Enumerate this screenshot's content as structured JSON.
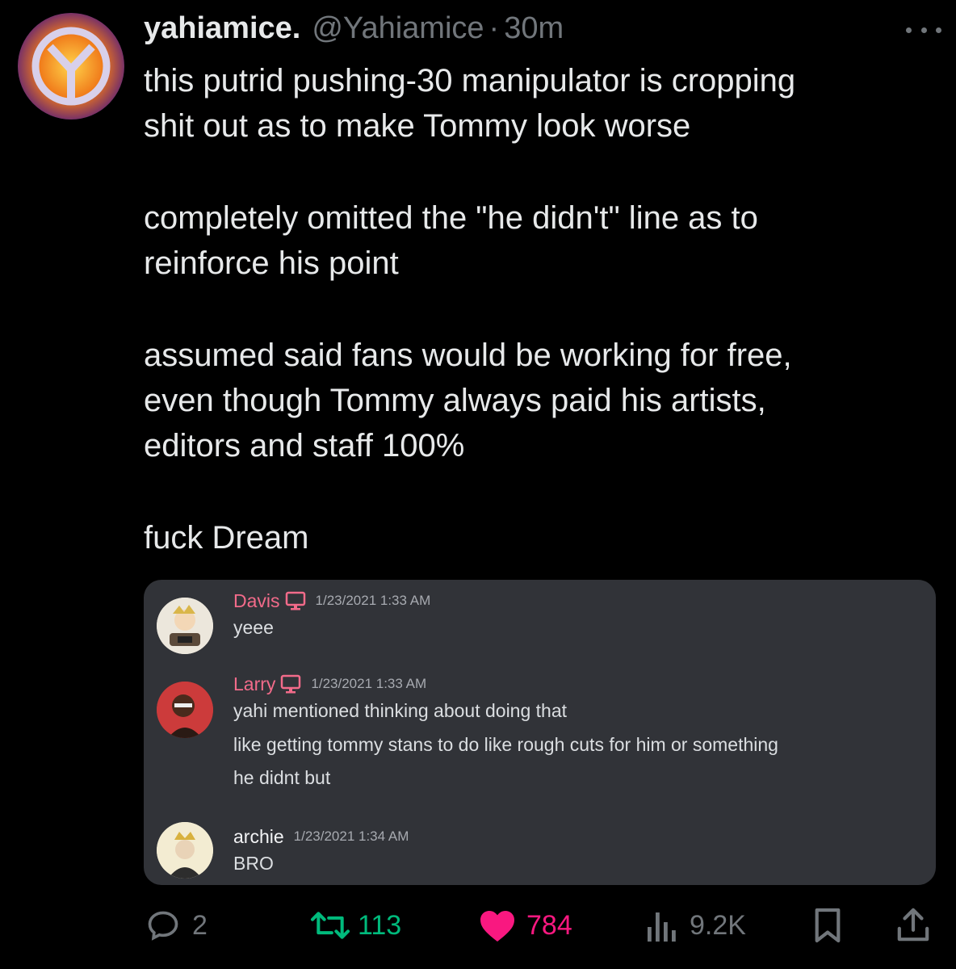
{
  "post": {
    "display_name": "yahiamice.",
    "handle": "@Yahiamice",
    "separator": "·",
    "time": "30m",
    "paragraphs": [
      [
        "this putrid pushing-30 manipulator is cropping",
        "shit out as to make Tommy look worse"
      ],
      [
        "completely omitted the \"he didn't\" line as to",
        "reinforce his point"
      ],
      [
        "assumed said fans would be working for free,",
        "even though Tommy always paid his artists,",
        "editors and staff 100%"
      ],
      [
        "fuck Dream"
      ]
    ]
  },
  "embed": {
    "messages": [
      {
        "author": "Davis",
        "author_color": "#f26b8a",
        "timestamp": "1/23/2021 1:33 AM",
        "lines": [
          "yeee"
        ]
      },
      {
        "author": "Larry",
        "author_color": "#f26b8a",
        "timestamp": "1/23/2021 1:33 AM",
        "lines": [
          "yahi mentioned thinking about doing that",
          "like getting tommy stans to do like rough cuts for him or something",
          "he didnt but"
        ]
      },
      {
        "author": "archie",
        "author_color": "#f2f3f5",
        "timestamp": "1/23/2021 1:34 AM",
        "lines": [
          "BRO"
        ]
      }
    ]
  },
  "actions": {
    "replies": "2",
    "reposts": "113",
    "likes": "784",
    "views": "9.2K",
    "icons": [
      "reply-icon",
      "repost-icon",
      "like-icon",
      "views-icon",
      "bookmark-icon",
      "share-icon"
    ],
    "colors": {
      "muted": "#71767b",
      "repost": "#00ba7c",
      "like": "#f91880"
    }
  }
}
